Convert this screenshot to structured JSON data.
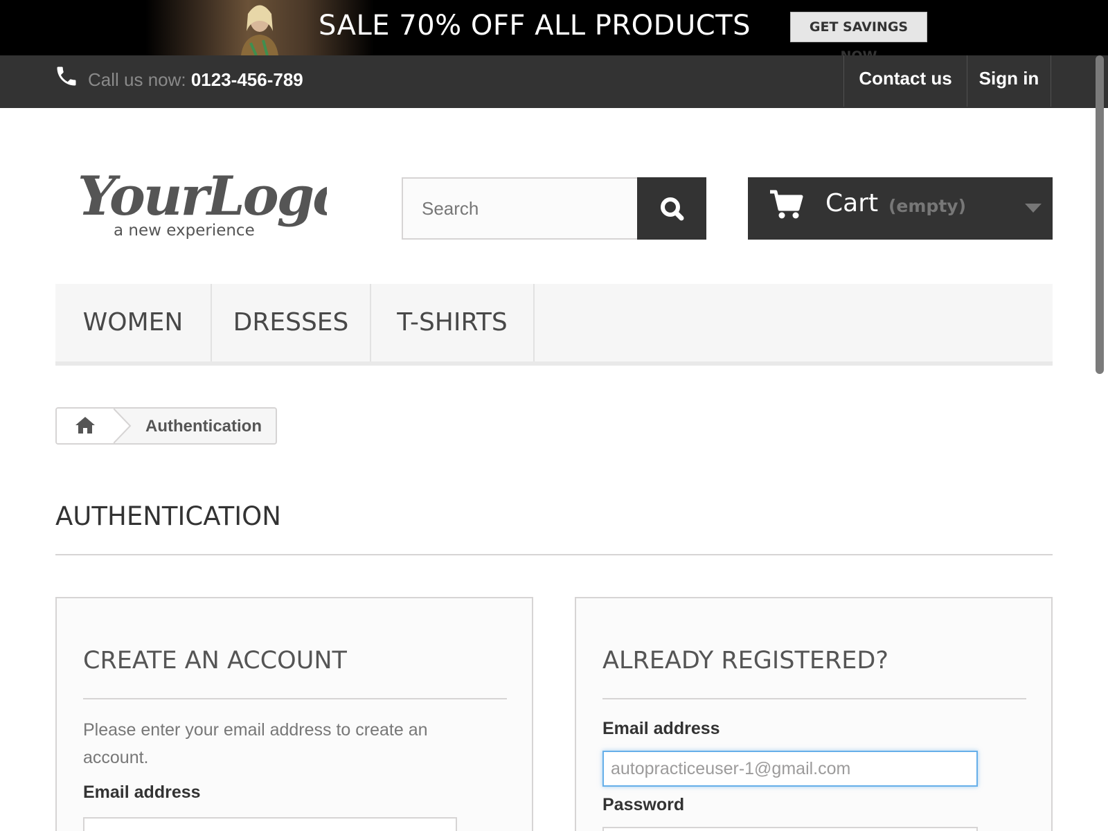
{
  "banner": {
    "text": "SALE 70% OFF ALL PRODUCTS",
    "button_label": "GET SAVINGS NOW"
  },
  "topnav": {
    "call_prefix": "Call us now: ",
    "phone": "0123-456-789",
    "contact_label": "Contact us",
    "signin_label": "Sign in"
  },
  "header": {
    "logo_text": "YourLogo",
    "logo_tagline": "a new experience",
    "search_placeholder": "Search",
    "cart_label": "Cart",
    "cart_status": "(empty)"
  },
  "menu": {
    "items": [
      {
        "label": "WOMEN"
      },
      {
        "label": "DRESSES"
      },
      {
        "label": "T-SHIRTS"
      }
    ]
  },
  "breadcrumb": {
    "current": "Authentication"
  },
  "page": {
    "title": "AUTHENTICATION"
  },
  "create_account": {
    "title": "CREATE AN ACCOUNT",
    "description": "Please enter your email address to create an account.",
    "email_label": "Email address",
    "email_value": ""
  },
  "login": {
    "title": "ALREADY REGISTERED?",
    "email_label": "Email address",
    "email_value": "autopracticeuser-1@gmail.com",
    "password_label": "Password"
  },
  "colors": {
    "banner_bg": "#000000",
    "nav_bg": "#333333",
    "focus_border": "#66afe9"
  }
}
